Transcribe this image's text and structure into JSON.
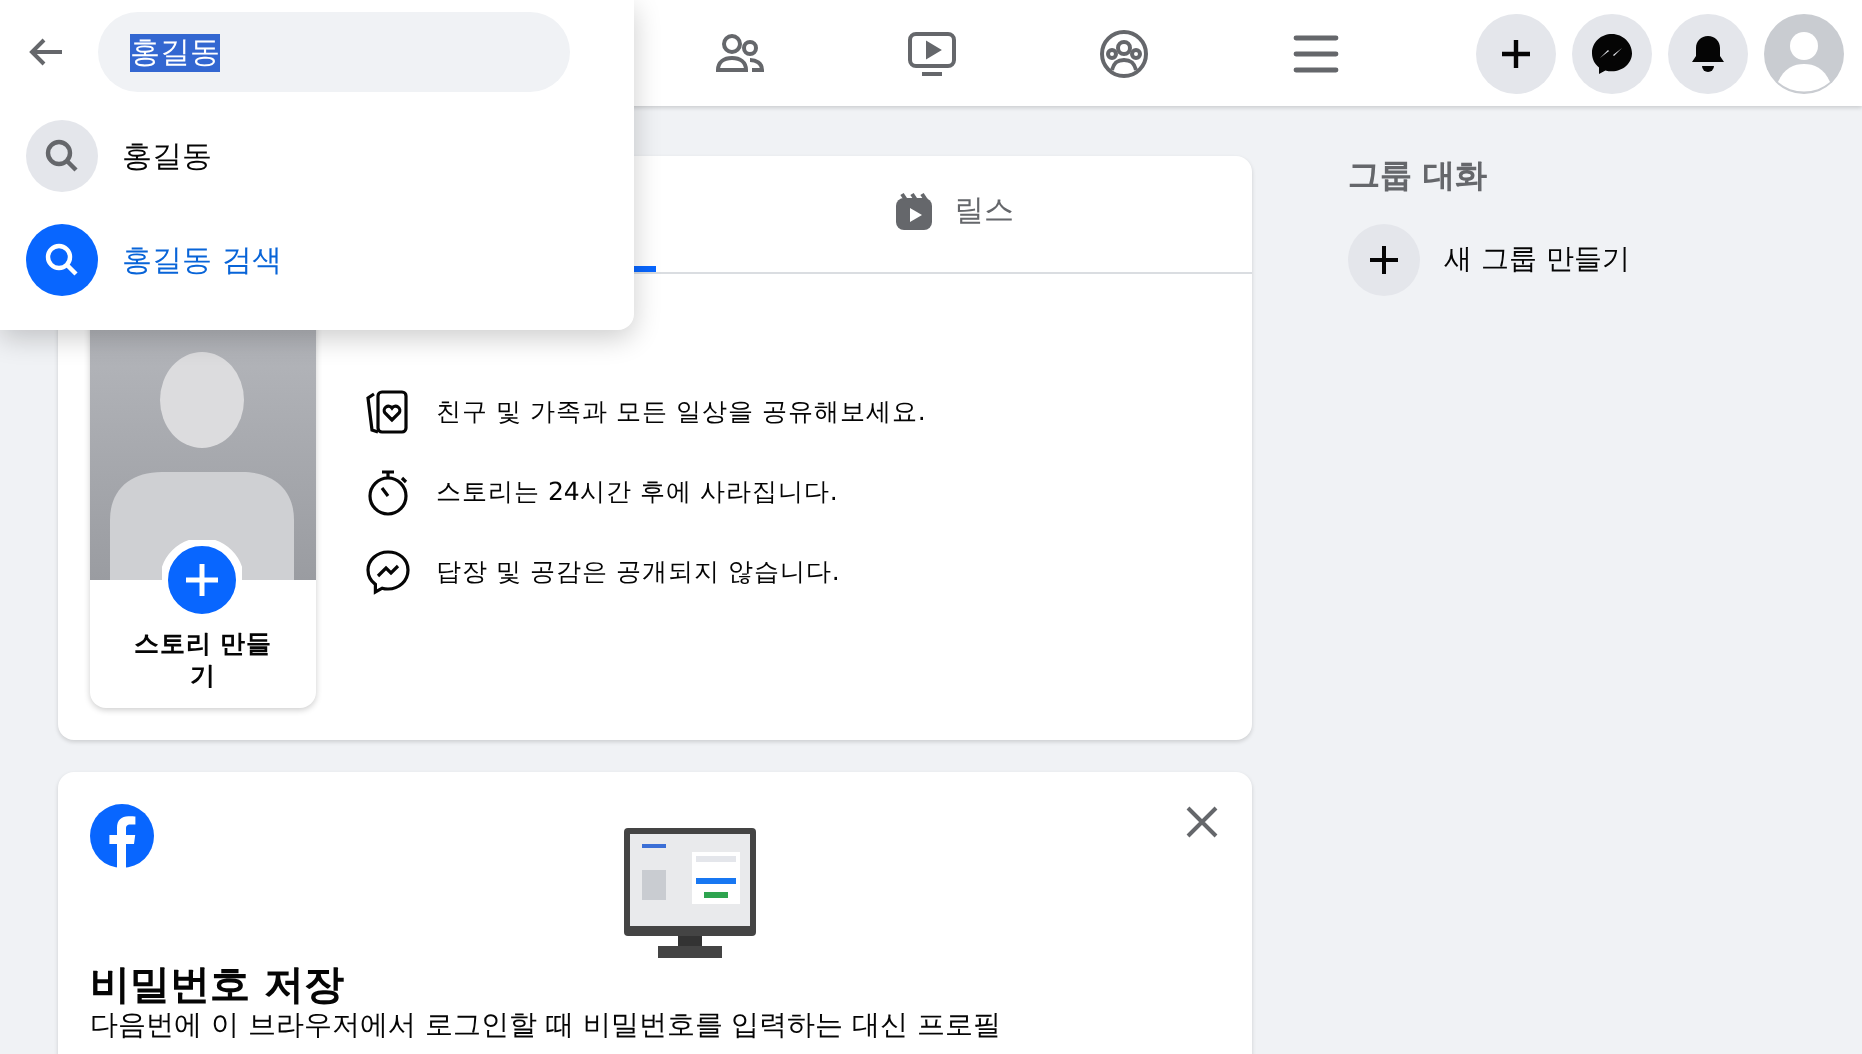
{
  "search": {
    "value": "홍길동",
    "text_selected": true
  },
  "suggestions": [
    {
      "kind": "query",
      "label": "홍길동"
    },
    {
      "kind": "search_action",
      "label": "홍길동 검색"
    }
  ],
  "stories": {
    "tabs": [
      {
        "selected": true
      },
      {
        "label": "릴스",
        "selected": false
      }
    ],
    "create_label": "스토리 만들기",
    "info": [
      {
        "kind": "share",
        "text": "친구 및 가족과 모든 일상을 공유해보세요."
      },
      {
        "kind": "timer",
        "text": "스토리는 24시간 후에 사라집니다."
      },
      {
        "kind": "messenger",
        "text": "답장 및 공감은 공개되지 않습니다."
      }
    ]
  },
  "password_card": {
    "title": "비밀번호 저장",
    "body": "다음번에 이 브라우저에서 로그인할 때 비밀번호를 입력하는 대신 프로필"
  },
  "sidebar": {
    "heading": "그룹 대화",
    "action": "새 그룹 만들기"
  }
}
